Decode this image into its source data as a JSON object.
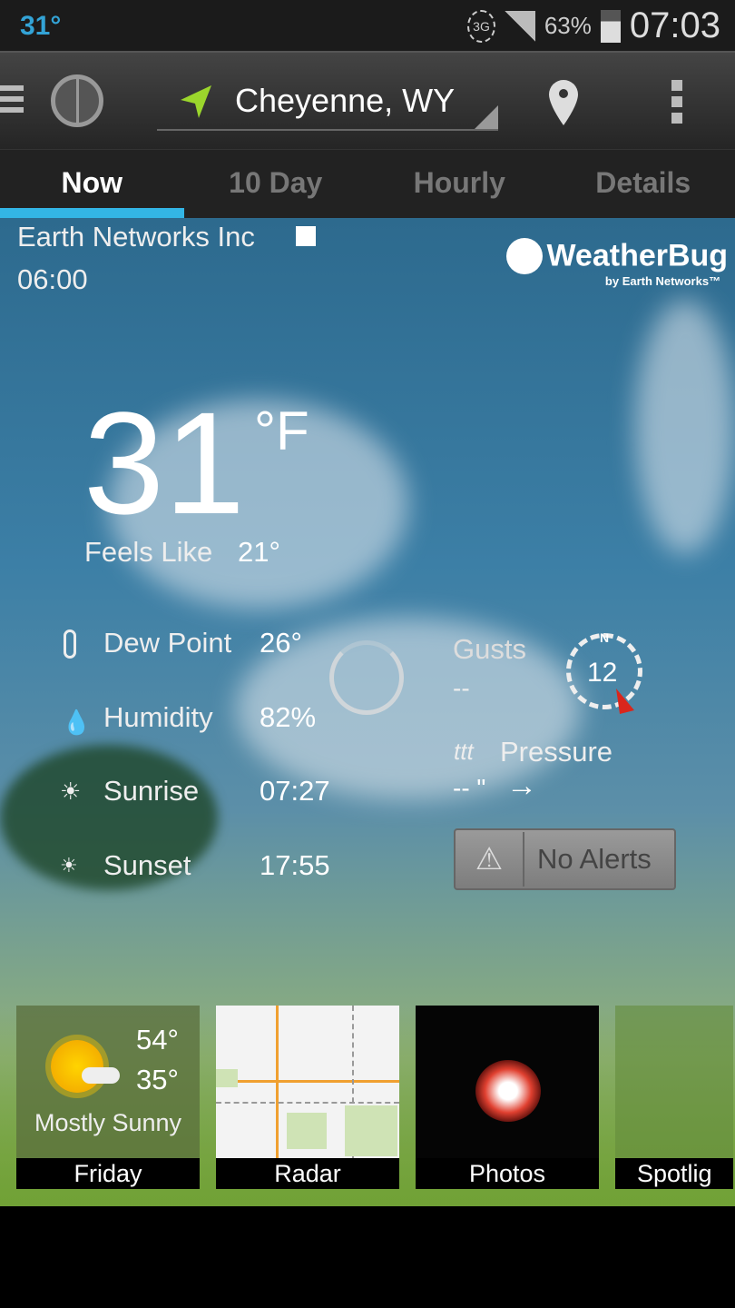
{
  "status_bar": {
    "temperature": "31°",
    "network": "3G",
    "battery": "63%",
    "time": "07:03"
  },
  "app_bar": {
    "location": "Cheyenne, WY",
    "icons": [
      "menu-icon",
      "weatherbug-logo-icon",
      "location-arrow-icon",
      "map-pin-icon",
      "overflow-menu-icon"
    ]
  },
  "tabs": [
    {
      "label": "Now",
      "active": true
    },
    {
      "label": "10 Day"
    },
    {
      "label": "Hourly"
    },
    {
      "label": "Details"
    }
  ],
  "current": {
    "source": "Earth Networks Inc",
    "time": "06:00",
    "temperature": "31",
    "unit": "°F",
    "feels_like_label": "Feels Like",
    "feels_like": "21°",
    "brand": "WeatherBug",
    "brand_sub": "by Earth Networks",
    "stats": [
      {
        "label": "Dew Point",
        "value": "26°",
        "icon": "thermometer-icon"
      },
      {
        "label": "Humidity",
        "value": "82%",
        "icon": "droplet-icon"
      },
      {
        "label": "Sunrise",
        "value": "07:27",
        "icon": "sunrise-icon"
      },
      {
        "label": "Sunset",
        "value": "17:55",
        "icon": "sunset-icon"
      }
    ],
    "gusts_label": "Gusts",
    "gusts_value": "--",
    "wind_speed": "12",
    "compass_north": "N",
    "pressure_label": "Pressure",
    "pressure_value": "-- \"",
    "alerts_label": "No Alerts"
  },
  "tiles": [
    {
      "label": "Friday",
      "high": "54°",
      "low": "35°",
      "condition": "Mostly Sunny"
    },
    {
      "label": "Radar"
    },
    {
      "label": "Photos"
    },
    {
      "label": "Spotlig"
    }
  ],
  "colors": {
    "accent": "#33b5e5",
    "status_temp": "#33a3d6",
    "location_arrow": "#9bd62c",
    "wind_arrow": "#d9261c"
  }
}
